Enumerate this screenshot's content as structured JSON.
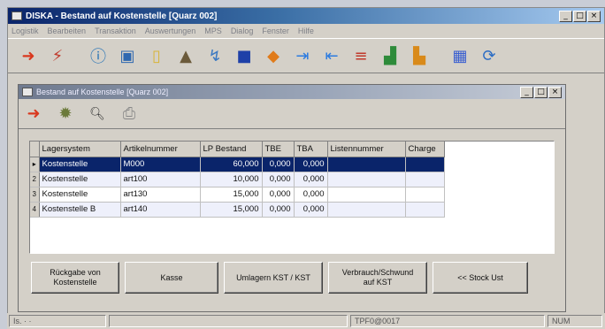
{
  "app": {
    "title": "DISKA - Bestand auf Kostenstelle [Quarz 002]",
    "window_buttons": [
      "_",
      "□",
      "×"
    ]
  },
  "menu": [
    "Logistik",
    "Bearbeiten",
    "Transaktion",
    "Auswertungen",
    "MPS",
    "Dialog",
    "Fenster",
    "Hilfe"
  ],
  "toolbar_icons": [
    "go-arrow-icon",
    "refresh-icon",
    "info-icon",
    "lock-icon",
    "document-icon",
    "truck-icon",
    "flow-icon",
    "camera-icon",
    "shapes-icon",
    "import-icon",
    "export-icon",
    "list-icon",
    "chart-icon",
    "report-icon",
    "grid-icon",
    "rotate-icon"
  ],
  "child": {
    "title": "Bestand auf Kostenstelle [Quarz 002]",
    "toolbar_icons": [
      "go-arrow-icon",
      "gear-icon",
      "preview-icon",
      "printer-icon"
    ]
  },
  "table": {
    "columns": [
      "Lagersystem",
      "Artikelnummer",
      "LP Bestand",
      "TBE",
      "TBA",
      "Listennummer",
      "Charge"
    ],
    "rows": [
      {
        "index": "▸",
        "lagersystem": "Kostenstelle",
        "artikel": "M000",
        "bestand": "60,000",
        "tbe": "0,000",
        "tba": "0,000",
        "liste": "",
        "charge": ""
      },
      {
        "index": "2",
        "lagersystem": "Kostenstelle",
        "artikel": "art100",
        "bestand": "10,000",
        "tbe": "0,000",
        "tba": "0,000",
        "liste": "",
        "charge": ""
      },
      {
        "index": "3",
        "lagersystem": "Kostenstelle",
        "artikel": "art130",
        "bestand": "15,000",
        "tbe": "0,000",
        "tba": "0,000",
        "liste": "",
        "charge": ""
      },
      {
        "index": "4",
        "lagersystem": "Kostenstelle B",
        "artikel": "art140",
        "bestand": "15,000",
        "tbe": "0,000",
        "tba": "0,000",
        "liste": "",
        "charge": ""
      }
    ]
  },
  "buttons": [
    {
      "label": "Rückgabe von\nKostenstelle",
      "name": "return-from-costcenter-button"
    },
    {
      "label": "Kasse",
      "name": "kasse-button"
    },
    {
      "label": "Umlagern KST / KST",
      "name": "transfer-kst-button"
    },
    {
      "label": "Verbrauch/Schwund\nauf KST",
      "name": "consumption-button"
    },
    {
      "label": "<< Stock Ust",
      "name": "stock-list-button"
    }
  ],
  "status": {
    "pane1": "Is. · ·",
    "pane3": "TPF0@0017",
    "pane4": "NUM"
  },
  "colors": {
    "title_active": "#0a246a",
    "selection": "#0a246a",
    "face": "#d4d0c8"
  }
}
